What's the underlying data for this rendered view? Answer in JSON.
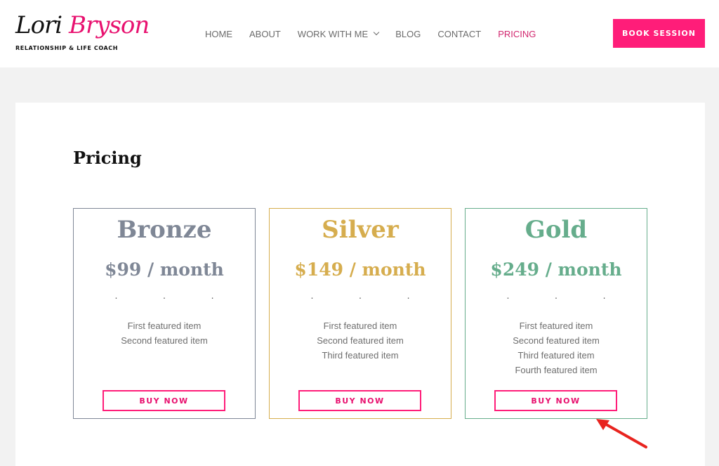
{
  "brand": {
    "first_name": "Lori",
    "last_name": "Bryson",
    "tagline": "RELATIONSHIP & LIFE COACH"
  },
  "nav": {
    "items": [
      {
        "label": "HOME"
      },
      {
        "label": "ABOUT"
      },
      {
        "label": "WORK WITH ME"
      },
      {
        "label": "BLOG"
      },
      {
        "label": "CONTACT"
      },
      {
        "label": "PRICING"
      }
    ],
    "active": "PRICING"
  },
  "header": {
    "book_label": "BOOK SESSION"
  },
  "main": {
    "title": "Pricing",
    "plans": [
      {
        "name": "Bronze",
        "price": "$99 / month",
        "dots": "· · ·",
        "features": [
          "First featured item",
          "Second featured item"
        ],
        "button": "BUY NOW",
        "color": "#7f8796"
      },
      {
        "name": "Silver",
        "price": "$149 / month",
        "dots": "· · ·",
        "features": [
          "First featured item",
          "Second featured item",
          "Third featured item"
        ],
        "button": "BUY NOW",
        "color": "#d6ad4e"
      },
      {
        "name": "Gold",
        "price": "$249 / month",
        "dots": "· · ·",
        "features": [
          "First featured item",
          "Second featured item",
          "Third featured item",
          "Fourth featured item"
        ],
        "button": "BUY NOW",
        "color": "#66ad8c"
      }
    ]
  },
  "colors": {
    "accent": "#ff1d79",
    "nav_active": "#d1266e",
    "annotation_arrow": "#e8241f"
  },
  "icons": {
    "nav_dropdown": "chevron-down-icon",
    "annotation": "red-arrow-icon"
  }
}
